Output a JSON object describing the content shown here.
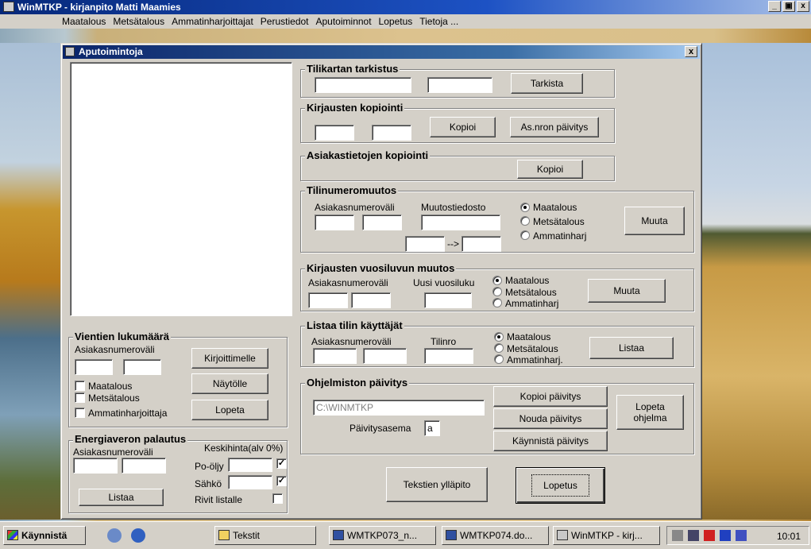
{
  "window": {
    "title": "WinMTKP - kirjanpito   Matti Maamies",
    "minimize": "_",
    "maximize": "ع",
    "close": "x"
  },
  "menu": [
    "Maatalous",
    "Metsätalous",
    "Ammatinharjoittajat",
    "Perustiedot",
    "Aputoiminnot",
    "Lopetus",
    "Tietoja ..."
  ],
  "dialog": {
    "title": "Aputoimintoja",
    "close": "x"
  },
  "tilikartta": {
    "legend": "Tilikartan tarkistus",
    "button": "Tarkista"
  },
  "kirjausten_kopiointi": {
    "legend": "Kirjausten kopiointi",
    "copy": "Kopioi",
    "renumber": "As.nron päivitys"
  },
  "asiakas_kopiointi": {
    "legend": "Asiakastietojen kopiointi",
    "copy": "Kopioi"
  },
  "tilinumeromuutos": {
    "legend": "Tilinumeromuutos",
    "range_label": "Asiakasnumeroväli",
    "file_label": "Muutostiedosto",
    "arrow": "-->",
    "options": [
      "Maatalous",
      "Metsätalous",
      "Ammatinharj"
    ],
    "selected": "Maatalous",
    "button": "Muuta"
  },
  "vuosiluku": {
    "legend": "Kirjausten vuosiluvun muutos",
    "range_label": "Asiakasnumeroväli",
    "year_label": "Uusi vuosiluku",
    "options": [
      "Maatalous",
      "Metsätalous",
      "Ammatinharj"
    ],
    "selected": "Maatalous",
    "button": "Muuta"
  },
  "listaa": {
    "legend": "Listaa tilin käyttäjät",
    "range_label": "Asiakasnumeroväli",
    "account_label": "Tilinro",
    "options": [
      "Maatalous",
      "Metsätalous",
      "Ammatinharj."
    ],
    "selected": "Maatalous",
    "button": "Listaa"
  },
  "paivitys": {
    "legend": "Ohjelmiston päivitys",
    "path_value": "C:\\WINMTKP",
    "drive_label": "Päivitysasema",
    "drive_value": "a",
    "copy": "Kopioi päivitys",
    "fetch": "Nouda päivitys",
    "start": "Käynnistä päivitys",
    "quit": "Lopeta ohjelma"
  },
  "vientien": {
    "legend": "Vientien lukumäärä",
    "range_label": "Asiakasnumeroväli",
    "checks": [
      "Maatalous",
      "Metsätalous",
      "Ammatinharjoittaja"
    ],
    "printer": "Kirjoittimelle",
    "screen": "Näytölle",
    "quit": "Lopeta"
  },
  "energia": {
    "legend": "Energiaveron palautus",
    "range_label": "Asiakasnumeroväli",
    "price_label": "Keskihinta(alv 0%)",
    "oil_label": "Po-öljy",
    "elec_label": "Sähkö",
    "rows_label": "Rivit listalle",
    "button": "Listaa"
  },
  "bottom": {
    "maintain": "Tekstien ylläpito",
    "exit": "Lopetus"
  },
  "taskbar": {
    "start": "Käynnistä",
    "items": [
      "Tekstit",
      "WMTKP073_n...",
      "WMTKP074.do...",
      "WinMTKP - kirj..."
    ],
    "clock": "10:01"
  }
}
